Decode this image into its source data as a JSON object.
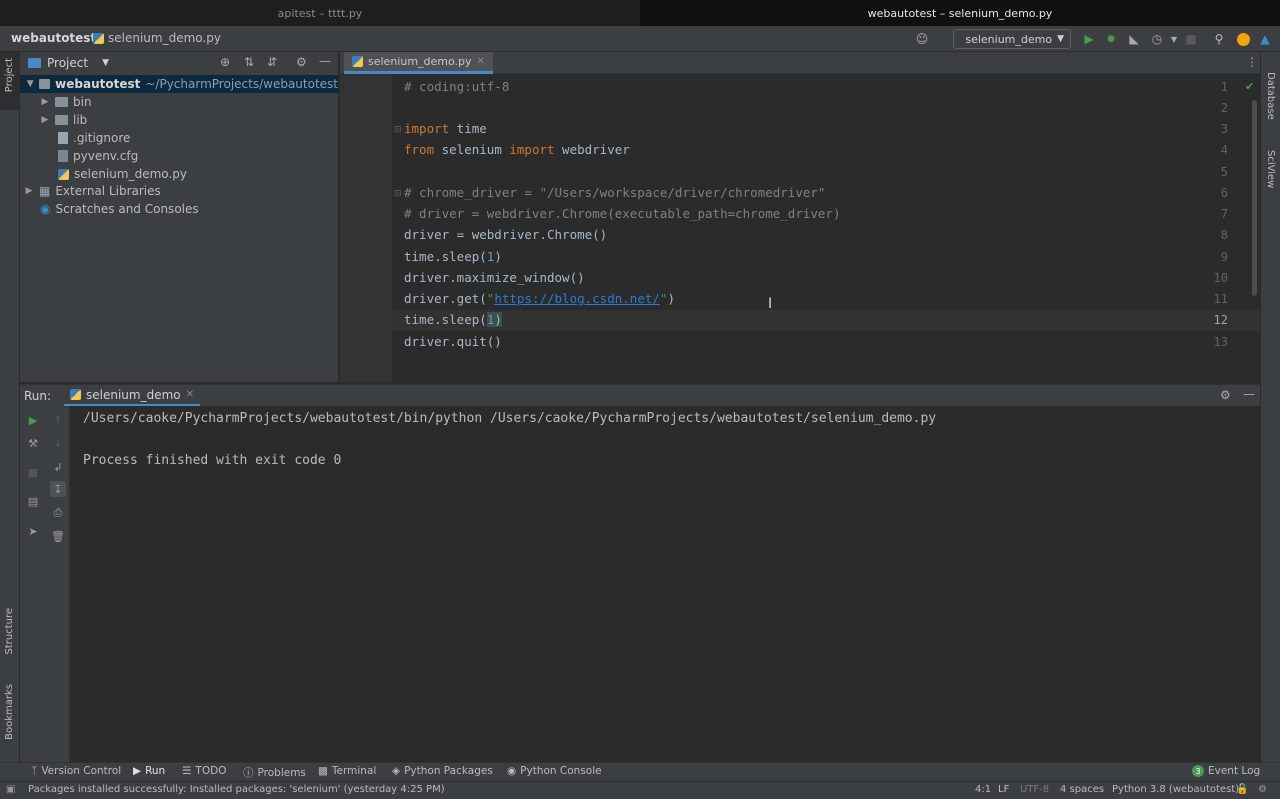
{
  "window_tabs": [
    "apitest – tttt.py",
    "webautotest – selenium_demo.py"
  ],
  "navbar": {
    "project": "webautotest",
    "file": "selenium_demo.py",
    "run_config": "selenium_demo"
  },
  "left_strip": {
    "project": "Project",
    "structure": "Structure",
    "bookmarks": "Bookmarks"
  },
  "right_strip": {
    "database": "Database",
    "sciview": "SciView"
  },
  "project_panel": {
    "title": "Project",
    "root": "webautotest",
    "root_path": "~/PycharmProjects/webautotest",
    "items": [
      "bin",
      "lib",
      ".gitignore",
      "pyvenv.cfg",
      "selenium_demo.py",
      "External Libraries",
      "Scratches and Consoles"
    ]
  },
  "editor": {
    "tab": "selenium_demo.py",
    "line_numbers": [
      "1",
      "2",
      "3",
      "4",
      "5",
      "6",
      "7",
      "8",
      "9",
      "10",
      "11",
      "12",
      "13"
    ],
    "lines": {
      "l1": "# coding:utf-8",
      "l3_kw": "import",
      "l3_rest": " time",
      "l4_kw1": "from",
      "l4_mid": " selenium ",
      "l4_kw2": "import",
      "l4_rest": " webdriver",
      "l6": "# chrome_driver = \"/Users/workspace/driver/chromedriver\"",
      "l7": "# driver = webdriver.Chrome(executable_path=chrome_driver)",
      "l8": "driver = webdriver.Chrome()",
      "l9_a": "time.sleep(",
      "l9_n": "1",
      "l9_b": ")",
      "l10": "driver.maximize_window()",
      "l11_a": "driver.get(",
      "l11_q1": "\"",
      "l11_url": "https://blog.csdn.net/",
      "l11_q2": "\"",
      "l11_b": ")",
      "l12_a": "time.sleep(",
      "l12_n": "1",
      "l12_b": ")",
      "l13": "driver.quit()"
    }
  },
  "run_panel": {
    "label": "Run:",
    "tab": "selenium_demo",
    "output": [
      "/Users/caoke/PycharmProjects/webautotest/bin/python /Users/caoke/PycharmProjects/webautotest/selenium_demo.py",
      "Process finished with exit code 0"
    ]
  },
  "tool_tabs": [
    "Version Control",
    "Run",
    "TODO",
    "Problems",
    "Terminal",
    "Python Packages",
    "Python Console"
  ],
  "event_log": {
    "count": "3",
    "label": "Event Log"
  },
  "status": {
    "message": "Packages installed successfully: Installed packages: 'selenium' (yesterday 4:25 PM)",
    "position": "4:1",
    "line_sep": "LF",
    "encoding": "UTF-8",
    "indent": "4 spaces",
    "interpreter": "Python 3.8 (webautotest)"
  },
  "colors": {
    "keyword": "#cc7832",
    "comment": "#808080",
    "number": "#6897bb",
    "string": "#6a8759",
    "run_green": "#499c54",
    "accent_blue": "#4a88c7"
  }
}
